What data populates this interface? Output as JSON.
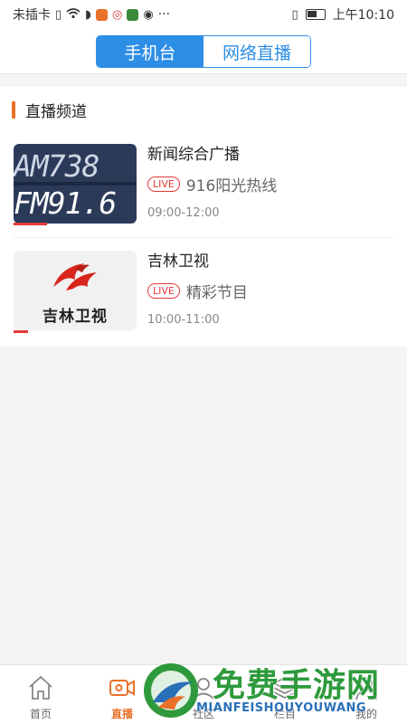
{
  "status_bar": {
    "carrier": "未插卡",
    "more": "···",
    "time": "上午10:10"
  },
  "header": {
    "tabs": [
      {
        "label": "手机台",
        "active": true
      },
      {
        "label": "网络直播",
        "active": false
      }
    ],
    "accent_color": "#2d8ee6"
  },
  "section": {
    "title": "直播频道",
    "accent_color": "#e9712a"
  },
  "channels": [
    {
      "thumb_line1": "AM738",
      "thumb_line2": "FM91.6",
      "title": "新闻综合广播",
      "badge": "LIVE",
      "program": "916阳光热线",
      "time": "09:00-12:00",
      "progress": 0.27
    },
    {
      "thumb_text": "吉林卫视",
      "title": "吉林卫视",
      "badge": "LIVE",
      "program": "精彩节目",
      "time": "10:00-11:00",
      "progress": 0.12
    }
  ],
  "tab_bar": {
    "items": [
      {
        "label": "首页",
        "icon": "home-icon",
        "active": false
      },
      {
        "label": "直播",
        "icon": "video-camera-icon",
        "active": true
      },
      {
        "label": "社区",
        "icon": "community-icon",
        "active": false
      },
      {
        "label": "栏目",
        "icon": "layers-icon",
        "active": false
      },
      {
        "label": "我的",
        "icon": "profile-icon",
        "active": false
      }
    ],
    "active_color": "#e9712a"
  },
  "watermark": {
    "title": "免费手游网",
    "subtitle": "MIANFEISHOUYOUWANG"
  }
}
